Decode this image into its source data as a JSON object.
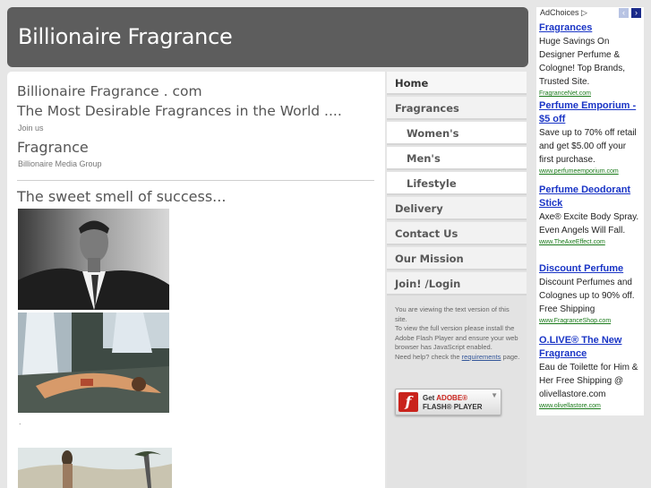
{
  "header": {
    "title": "Billionaire Fragrance"
  },
  "content": {
    "line1": "Billionaire Fragrance . com",
    "line2": "The Most Desirable Fragrances in the World ....",
    "join_link": "Join us",
    "fragrance_heading": "Fragrance",
    "media_group": "Billionaire Media Group",
    "tagline": "The sweet smell of success...",
    "dot": "."
  },
  "nav": {
    "items": [
      {
        "label": "Home"
      },
      {
        "label": "Fragrances"
      },
      {
        "label": "Women's"
      },
      {
        "label": "Men's"
      },
      {
        "label": "Lifestyle"
      },
      {
        "label": "Delivery"
      },
      {
        "label": "Contact Us"
      },
      {
        "label": "Our Mission"
      },
      {
        "label": "Join! /Login"
      }
    ],
    "info_line1": "You are viewing the text version of this site.",
    "info_line2": "To view the full version please install the Adobe Flash Player and ensure your web browser has JavaScript enabled.",
    "info_line3": "Need help? check the",
    "info_link": "requirements",
    "info_line4": "page.",
    "flash_get": "Get",
    "flash_adobe": "ADOBE®",
    "flash_player": "FLASH® PLAYER"
  },
  "ads": {
    "adchoices": "AdChoices",
    "items": [
      {
        "title": "Fragrances",
        "body": "Huge Savings On Designer Perfume & Cologne! Top Brands, Trusted Site.",
        "url": "FragranceNet.com"
      },
      {
        "title": "Perfume Emporium - $5 off",
        "body": "Save up to 70% off retail and get $5.00 off your first purchase.",
        "url": "www.perfumeemporium.com"
      },
      {
        "title": "Perfume Deodorant Stick",
        "body": "Axe® Excite Body Spray. Even Angels Will Fall.",
        "url": "www.TheAxeEffect.com"
      },
      {
        "title": "Discount Perfume",
        "body": "Discount Perfumes and Colognes up to 90% off. Free Shipping",
        "url": "www.FragranceShop.com"
      },
      {
        "title": "O.LIVE® The New Fragrance",
        "body": "Eau de Toilette for Him & Her Free Shipping @ olivellastore.com",
        "url": "www.olivellastore.com"
      }
    ]
  }
}
